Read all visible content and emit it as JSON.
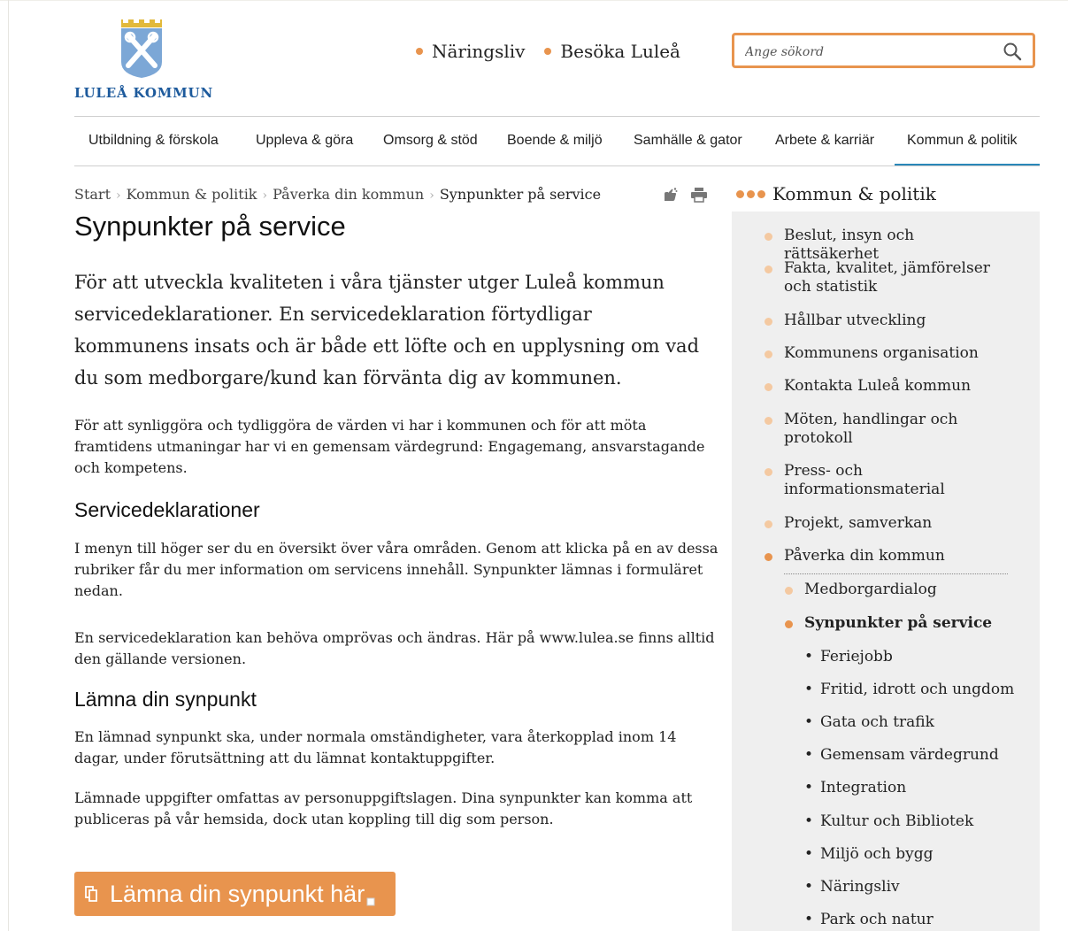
{
  "logo": {
    "text": "LULEÅ KOMMUN"
  },
  "top_links": [
    {
      "label": "Näringsliv"
    },
    {
      "label": "Besöka Luleå"
    }
  ],
  "search": {
    "placeholder": "Ange sökord",
    "value": ""
  },
  "main_nav": [
    {
      "label": "Utbildning & förskola"
    },
    {
      "label": "Uppleva & göra"
    },
    {
      "label": "Omsorg & stöd"
    },
    {
      "label": "Boende & miljö"
    },
    {
      "label": "Samhälle & gator"
    },
    {
      "label": "Arbete & karriär"
    },
    {
      "label": "Kommun & politik",
      "active": true
    }
  ],
  "breadcrumb": [
    {
      "label": "Start"
    },
    {
      "label": "Kommun & politik"
    },
    {
      "label": "Påverka din kommun"
    },
    {
      "label": "Synpunkter på service",
      "current": true
    }
  ],
  "content": {
    "title": "Synpunkter på service",
    "lead": "För att utveckla kvaliteten i våra tjänster utger Luleå kommun servicedeklarationer. En servicedeklaration förtydligar kommunens insats och är både ett löfte och en upplysning om vad du som medborgare/kund kan förvänta dig av kommunen.",
    "p1": "För att synliggöra och tydliggöra de värden vi har i kommunen och för att möta framtidens utmaningar har vi en gemensam värdegrund: Engagemang, ansvarstagande och kompetens.",
    "h2_services": "Servicedeklarationer",
    "p2": "I menyn till höger ser du en översikt över våra områden. Genom att klicka på en av dessa rubriker får du mer information om servicens innehåll. Synpunkter lämnas i formuläret nedan.",
    "p3": "En servicedeklaration kan behöva omprövas och ändras. Här på www.lulea.se finns alltid den gällande versionen.",
    "h2_feedback": "Lämna din synpunkt",
    "p4": "En lämnad synpunkt ska, under normala omständigheter, vara återkopplad inom 14 dagar, under förutsättning att du lämnat kontaktuppgifter.",
    "p5": "Lämnade uppgifter omfattas av personuppgiftslagen. Dina synpunkter kan komma att publiceras på vår hemsida, dock utan koppling till dig som person.",
    "cta_label": "Lämna din synpunkt här"
  },
  "sidebar": {
    "heading": "Kommun & politik",
    "items": [
      {
        "label": "Beslut, insyn och rättsäkerhet"
      },
      {
        "label": "Fakta, kvalitet, jämförelser och statistik"
      },
      {
        "label": "Hållbar utveckling"
      },
      {
        "label": "Kommunens organisation"
      },
      {
        "label": "Kontakta Luleå kommun"
      },
      {
        "label": "Möten, handlingar och protokoll"
      },
      {
        "label": "Press- och informationsmaterial"
      },
      {
        "label": "Projekt, samverkan"
      },
      {
        "label": "Påverka din kommun"
      }
    ],
    "sub_items": [
      {
        "label": "Medborgardialog"
      },
      {
        "label": "Synpunkter på service",
        "current": true
      }
    ],
    "leaf_items": [
      {
        "label": "Feriejobb"
      },
      {
        "label": "Fritid, idrott och ungdom"
      },
      {
        "label": "Gata och trafik"
      },
      {
        "label": "Gemensam värdegrund"
      },
      {
        "label": "Integration"
      },
      {
        "label": "Kultur och Bibliotek"
      },
      {
        "label": "Miljö och bygg"
      },
      {
        "label": "Näringsliv"
      },
      {
        "label": "Park och natur"
      }
    ]
  },
  "colors": {
    "accent": "#e8944e",
    "accent_light": "#f4c9a1",
    "nav_active": "#2a87b8",
    "logo_blue": "#1d5a9c"
  },
  "icons": [
    "search-icon",
    "share-icon",
    "print-icon",
    "copy-icon",
    "coat-of-arms-icon"
  ]
}
